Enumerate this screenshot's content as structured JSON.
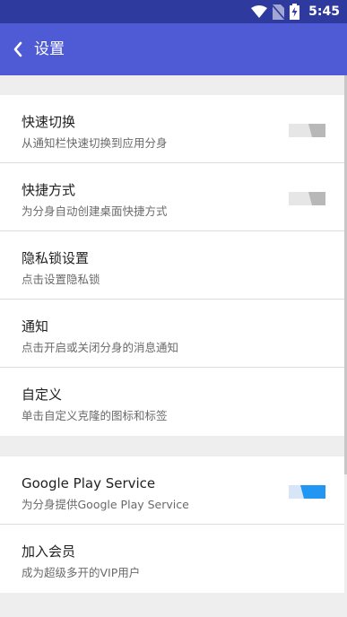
{
  "status": {
    "time": "5:45"
  },
  "appbar": {
    "title": "设置"
  },
  "settings": [
    {
      "title": "快速切换",
      "subtitle": "从通知栏快速切换到应用分身",
      "toggle": "off"
    },
    {
      "title": "快捷方式",
      "subtitle": "为分身自动创建桌面快捷方式",
      "toggle": "off"
    },
    {
      "title": "隐私锁设置",
      "subtitle": "点击设置隐私锁"
    },
    {
      "title": "通知",
      "subtitle": "点击开启或关闭分身的消息通知"
    },
    {
      "title": "自定义",
      "subtitle": "单击自定义克隆的图标和标签"
    }
  ],
  "services": [
    {
      "title": "Google Play Service",
      "subtitle": "为分身提供Google Play Service",
      "toggle": "on"
    },
    {
      "title": "加入会员",
      "subtitle": "成为超级多开的VIP用户"
    }
  ],
  "colors": {
    "status_bar": "#2f3a9e",
    "app_bar": "#4f5bd5",
    "toggle_on": "#2196f3",
    "toggle_off": "#bdbdbd"
  }
}
